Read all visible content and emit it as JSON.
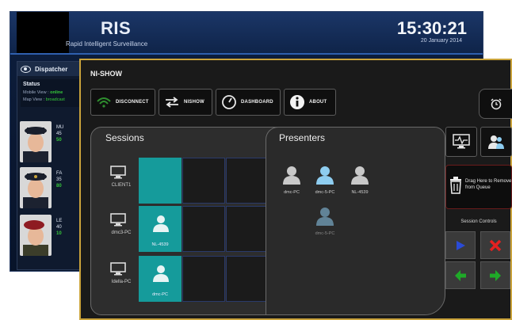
{
  "ris": {
    "title": "RIS",
    "subtitle": "Rapid Intelligent Surveillance",
    "clock": "15:30:21",
    "date": "20 January 2014",
    "dispatcher": {
      "label": "Dispatcher",
      "status_title": "Status",
      "mobile_view_label": "Mobile View :",
      "mobile_view_value": "online",
      "map_view_label": "Map View :",
      "map_view_value": "broadcast"
    },
    "officers": [
      {
        "line1": "MU",
        "line2": "45",
        "line3": "50"
      },
      {
        "line1": "FA",
        "line2": "35",
        "line3": "80"
      },
      {
        "line1": "LE",
        "line2": "40",
        "line3": "10"
      }
    ]
  },
  "nishow": {
    "title": "NI-SHOW",
    "toolbar": {
      "disconnect": "DISCONNECT",
      "nishow": "NISHOW",
      "dashboard": "DASHBOARD",
      "about": "ABOUT"
    },
    "sessions_heading": "Sessions",
    "presenters_heading": "Presenters",
    "sessions": [
      {
        "client": "CLIENT1",
        "slot_label": ""
      },
      {
        "client": "dmc3-PC",
        "slot_label": "NL-4539"
      },
      {
        "client": "Idella-PC",
        "slot_label": "dmc-PC"
      }
    ],
    "presenters": [
      {
        "name": "dmc-PC"
      },
      {
        "name": "dmc-5-PC"
      },
      {
        "name": "NL-4539"
      },
      {
        "name": "dmc-5-PC"
      }
    ],
    "remove_text": "Drag Here to Remove from Queue",
    "session_controls_label": "Session Controls"
  },
  "colors": {
    "accent_teal": "#159b9b",
    "frame_gold": "#caa33b",
    "ris_blue": "#0d1f3f",
    "online_green": "#36c93a"
  }
}
